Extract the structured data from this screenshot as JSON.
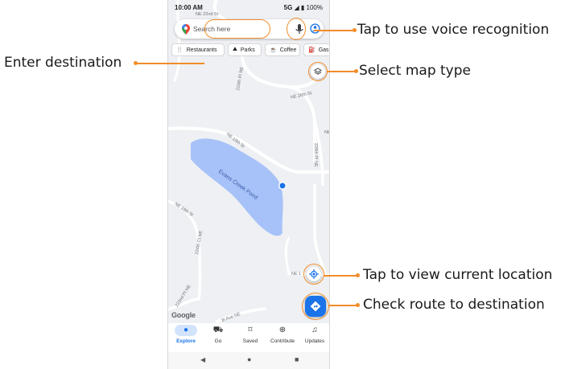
{
  "callouts": {
    "voice": "Tap to use voice recognition",
    "destination": "Enter destination",
    "map_type": "Select map type",
    "location": "Tap to view current location",
    "route": "Check route to destination"
  },
  "status_bar": {
    "time": "10:00 AM",
    "signal": "5G",
    "battery": "100%"
  },
  "search": {
    "placeholder": "Search here"
  },
  "chips": [
    {
      "label": "Restaurants",
      "icon": "fork-knife-icon"
    },
    {
      "label": "Parks",
      "icon": "tree-icon"
    },
    {
      "label": "Coffee",
      "icon": "coffee-cup-icon"
    },
    {
      "label": "Gas",
      "icon": "gas-pump-icon"
    }
  ],
  "map": {
    "lake_name": "Evans Creek Pond",
    "street_labels": [
      "NE 22nd St",
      "224th PI NE",
      "NE 20th St",
      "NE 19th St",
      "226th PI NE",
      "NE 18th St",
      "224th Ct NE",
      "222nd PI NE",
      "NE 1",
      "NE 20th",
      "th Ave NE",
      "NE"
    ],
    "logo": "Google"
  },
  "bottom_nav": [
    {
      "label": "Explore",
      "icon": "pin-icon",
      "active": true
    },
    {
      "label": "Go",
      "icon": "car-icon",
      "active": false
    },
    {
      "label": "Saved",
      "icon": "bookmark-icon",
      "active": false
    },
    {
      "label": "Contribute",
      "icon": "plus-circle-icon",
      "active": false
    },
    {
      "label": "Updates",
      "icon": "bell-icon",
      "active": false
    }
  ],
  "colors": {
    "accent": "#1a73e8",
    "callout": "#f28c28",
    "water": "#a7c2f8"
  }
}
